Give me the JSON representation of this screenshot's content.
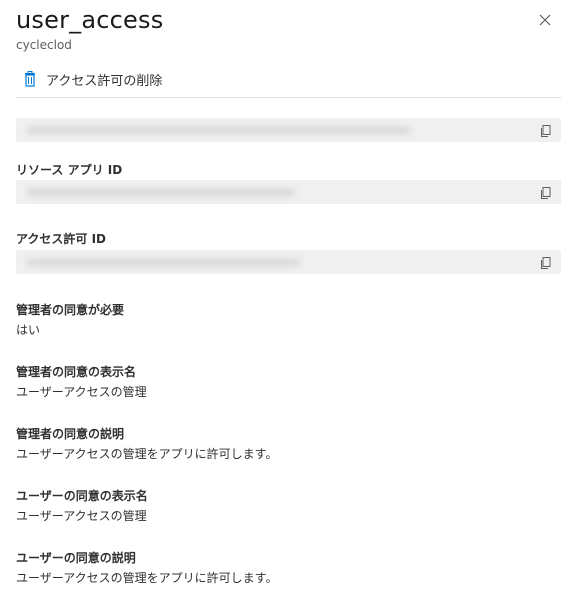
{
  "header": {
    "title": "user_access",
    "subtitle": "cycleclod"
  },
  "toolbar": {
    "delete_label": "アクセス許可の削除"
  },
  "fields": {
    "resource_app_id_label": "リソース アプリ ID",
    "permission_id_label": "アクセス許可 ID",
    "admin_consent_required_label": "管理者の同意が必要",
    "admin_consent_required_value": "はい",
    "admin_consent_display_name_label": "管理者の同意の表示名",
    "admin_consent_display_name_value": "ユーザーアクセスの管理",
    "admin_consent_description_label": "管理者の同意の説明",
    "admin_consent_description_value": "ユーザーアクセスの管理をアプリに許可します。",
    "user_consent_display_name_label": "ユーザーの同意の表示名",
    "user_consent_display_name_value": "ユーザーアクセスの管理",
    "user_consent_description_label": "ユーザーの同意の説明",
    "user_consent_description_value": "ユーザーアクセスの管理をアプリに許可します。"
  },
  "icons": {
    "close": "close-icon",
    "delete": "trash-icon",
    "copy": "copy-icon"
  },
  "colors": {
    "accent": "#0078d4",
    "masked_background": "#f0f0f0"
  }
}
